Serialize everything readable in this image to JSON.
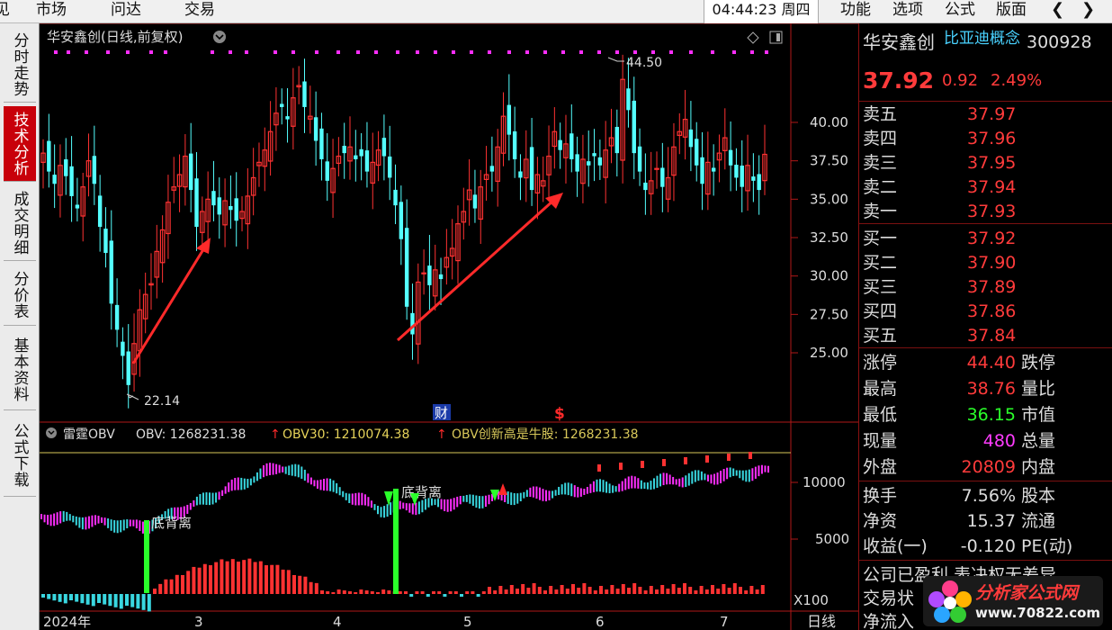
{
  "menu": {
    "items": [
      "见",
      "市场",
      "问达",
      "交易"
    ],
    "clock": "04:44:23 周四",
    "right_items": [
      "功能",
      "选项",
      "公式",
      "版面"
    ]
  },
  "side_tabs": [
    "分时走势",
    "技术分析",
    "成交明细",
    "分价表",
    "基本资料",
    "公式下载"
  ],
  "active_tab": 1,
  "chart": {
    "title": "华安鑫创(日线,前复权)",
    "price_labels": [
      "40.00",
      "37.50",
      "35.00",
      "32.50",
      "30.00",
      "27.50",
      "25.00"
    ],
    "high_annot": "44.50",
    "low_annot": "22.14",
    "event_cai": "财",
    "event_dollar": "$",
    "obv_name": "雷霆OBV",
    "obv_text": "OBV: 1268231.38",
    "obv30_text": "OBV30: 1210074.38",
    "obv_new_high_text": "OBV创新高是牛股: 1268231.38",
    "obv_labels": [
      "10000",
      "5000"
    ],
    "obv_unit": "X100",
    "div_label_1": "底背离",
    "div_label_2": "底背离",
    "date_labels": [
      "2024年",
      "3",
      "4",
      "5",
      "6",
      "7"
    ],
    "period": "日线"
  },
  "colors": {
    "up": "#ff3232",
    "down": "#54ffff",
    "magenta": "#ff2eff",
    "cyan": "#39d7e0",
    "green": "#2aff2a",
    "axis": "#b01818",
    "gold": "#d8c85a"
  },
  "stock": {
    "name": "华安鑫创",
    "concept": "比亚迪概念",
    "code": "300928",
    "price": "37.92",
    "change": "0.92",
    "change_pct": "2.49%"
  },
  "orderbook": {
    "asks": [
      {
        "label": "卖五",
        "price": "37.97"
      },
      {
        "label": "卖四",
        "price": "37.96"
      },
      {
        "label": "卖三",
        "price": "37.95"
      },
      {
        "label": "卖二",
        "price": "37.94"
      },
      {
        "label": "卖一",
        "price": "37.93"
      }
    ],
    "bids": [
      {
        "label": "买一",
        "price": "37.92"
      },
      {
        "label": "买二",
        "price": "37.90"
      },
      {
        "label": "买三",
        "price": "37.89"
      },
      {
        "label": "买四",
        "price": "37.86"
      },
      {
        "label": "买五",
        "price": "37.84"
      }
    ]
  },
  "stats": [
    {
      "label": "涨停",
      "value": "44.40",
      "label2": "跌停",
      "color": "#ff3b3b"
    },
    {
      "label": "最高",
      "value": "38.76",
      "label2": "量比",
      "color": "#ff3b3b"
    },
    {
      "label": "最低",
      "value": "36.15",
      "label2": "市值",
      "color": "#2aff2a"
    },
    {
      "label": "现量",
      "value": "480",
      "label2": "总量",
      "color": "#ff3cff"
    },
    {
      "label": "外盘",
      "value": "20809",
      "label2": "内盘",
      "color": "#ff3b3b"
    }
  ],
  "finance": [
    {
      "label": "换手",
      "value": "7.56%",
      "label2": "股本"
    },
    {
      "label": "净资",
      "value": "15.37",
      "label2": "流通"
    },
    {
      "label": "收益(一)",
      "value": "-0.120",
      "label2": "PE(动)"
    }
  ],
  "footer_rows": [
    "公司已盈利,表决权无差异",
    "交易状",
    "净流入"
  ],
  "logo": {
    "title": "分析家公式网",
    "url": "www.70822.com"
  },
  "chart_data": {
    "type": "candlestick",
    "title": "华安鑫创(日线,前复权)",
    "y_axis_ticks": [
      40.0,
      37.5,
      35.0,
      32.5,
      30.0,
      27.5,
      25.0
    ],
    "ylim": [
      22.14,
      44.5
    ],
    "annotations": {
      "high": 44.5,
      "low": 22.14
    },
    "x_labels": [
      "2024年",
      "3",
      "4",
      "5",
      "6",
      "7"
    ],
    "close_series": [
      38.0,
      36.8,
      36.0,
      37.2,
      36.5,
      35.2,
      34.4,
      35.8,
      37.5,
      36.0,
      33.2,
      31.5,
      28.2,
      26.5,
      24.8,
      22.9,
      25.6,
      27.8,
      28.8,
      29.5,
      31.6,
      33.0,
      34.8,
      35.8,
      36.6,
      37.8,
      35.6,
      33.2,
      34.2,
      35.0,
      34.6,
      34.0,
      34.9,
      34.3,
      33.6,
      34.2,
      35.2,
      36.4,
      37.4,
      38.2,
      39.4,
      40.6,
      41.0,
      40.2,
      41.6,
      42.4,
      41.0,
      40.4,
      38.8,
      37.6,
      36.2,
      37.0,
      37.8,
      38.0,
      38.4,
      37.6,
      37.8,
      36.8,
      37.4,
      38.2,
      37.8,
      36.4,
      34.6,
      32.4,
      28.0,
      26.2,
      29.6,
      30.2,
      29.4,
      30.4,
      29.8,
      31.2,
      31.8,
      33.4,
      34.2,
      35.6,
      34.4,
      35.8,
      36.6,
      36.8,
      38.4,
      40.4,
      39.2,
      37.6,
      36.4,
      37.6,
      35.6,
      36.6,
      36.2,
      37.8,
      39.4,
      38.2,
      38.6,
      37.6,
      36.8,
      37.6,
      37.2,
      37.8,
      37.2,
      38.2,
      39.0,
      38.0,
      42.8,
      40.8,
      38.0,
      36.8,
      35.6,
      36.2,
      37.0,
      35.8,
      36.4,
      38.4,
      39.4,
      40.2,
      38.4,
      37.2,
      36.0,
      37.4,
      36.8,
      38.0,
      39.0,
      37.2,
      36.4,
      35.8,
      37.2,
      36.2,
      35.6,
      37.92
    ]
  }
}
